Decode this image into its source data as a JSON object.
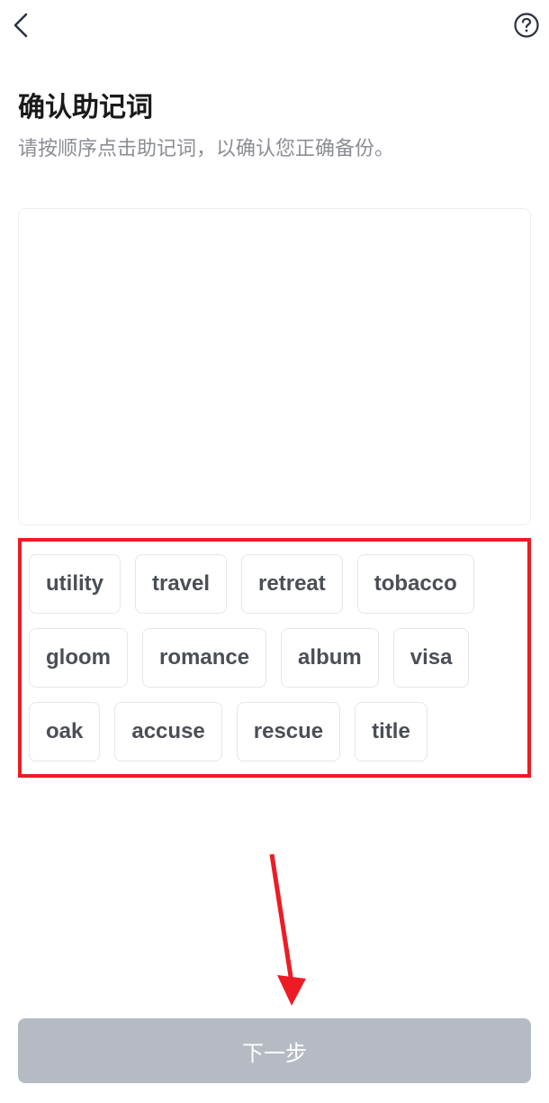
{
  "header": {
    "back_icon": "chevron-left",
    "help_icon": "question-mark"
  },
  "page": {
    "title": "确认助记词",
    "subtitle": "请按顺序点击助记词，以确认您正确备份。"
  },
  "words": [
    "utility",
    "travel",
    "retreat",
    "tobacco",
    "gloom",
    "romance",
    "album",
    "visa",
    "oak",
    "accuse",
    "rescue",
    "title"
  ],
  "footer": {
    "next_button": "下一步"
  },
  "colors": {
    "highlight_box": "#ed1c24",
    "arrow": "#ed1c24",
    "button_bg": "#b6bbc3",
    "text_dark": "#1a1a1a",
    "text_gray": "#8b8e94",
    "chip_text": "#4a4f57",
    "border_light": "#e5e7ea"
  }
}
